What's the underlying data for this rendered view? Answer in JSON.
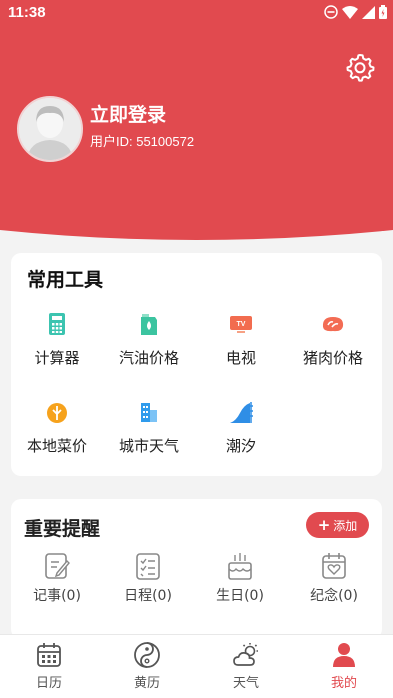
{
  "status_bar": {
    "time": "11:38"
  },
  "profile": {
    "login_label": "立即登录",
    "user_id": "用户ID: 55100572"
  },
  "tools": {
    "title": "常用工具",
    "items": [
      {
        "label": "计算器",
        "icon": "calculator-icon"
      },
      {
        "label": "汽油价格",
        "icon": "fuel-can-icon"
      },
      {
        "label": "电视",
        "icon": "tv-icon"
      },
      {
        "label": "猪肉价格",
        "icon": "meat-icon"
      },
      {
        "label": "本地菜价",
        "icon": "vegetable-icon"
      },
      {
        "label": "城市天气",
        "icon": "city-building-icon"
      },
      {
        "label": "潮汐",
        "icon": "wave-icon"
      }
    ]
  },
  "reminders": {
    "title": "重要提醒",
    "add_label": "添加",
    "items": [
      {
        "label": "记事(0)",
        "icon": "note-icon"
      },
      {
        "label": "日程(0)",
        "icon": "checklist-icon"
      },
      {
        "label": "生日(0)",
        "icon": "cake-icon"
      },
      {
        "label": "纪念(0)",
        "icon": "heart-calendar-icon"
      }
    ]
  },
  "tabs": [
    {
      "label": "日历",
      "icon": "calendar-icon",
      "active": false
    },
    {
      "label": "黄历",
      "icon": "yin-yang-icon",
      "active": false
    },
    {
      "label": "天气",
      "icon": "weather-icon",
      "active": false
    },
    {
      "label": "我的",
      "icon": "person-icon",
      "active": true
    }
  ],
  "colors": {
    "brand_red": "#e14a4f",
    "background": "#f3f3f3"
  }
}
